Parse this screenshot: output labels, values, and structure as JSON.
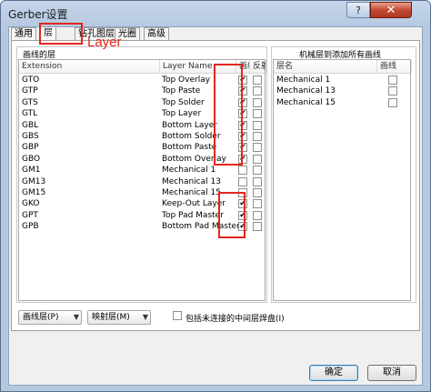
{
  "window": {
    "title": "Gerber设置",
    "help_label": "?",
    "close_label": "✕"
  },
  "tabs": [
    {
      "label": "通用",
      "active": false
    },
    {
      "label": "层",
      "active": true
    },
    {
      "label": "钻孔图层",
      "active": false
    },
    {
      "label": "光圈",
      "active": false
    },
    {
      "label": "高级",
      "active": false
    }
  ],
  "annotation": {
    "text": "Layer",
    "color": "#e5261f"
  },
  "left_group": {
    "title": "画线的层",
    "columns": [
      "Extension",
      "Layer Name",
      "画线",
      "反射"
    ],
    "rows": [
      {
        "ext": "GTO",
        "name": "Top Overlay",
        "plot": true,
        "mirror": false
      },
      {
        "ext": "GTP",
        "name": "Top Paste",
        "plot": true,
        "mirror": false
      },
      {
        "ext": "GTS",
        "name": "Top Solder",
        "plot": true,
        "mirror": false
      },
      {
        "ext": "GTL",
        "name": "Top Layer",
        "plot": true,
        "mirror": false
      },
      {
        "ext": "GBL",
        "name": "Bottom Layer",
        "plot": true,
        "mirror": false
      },
      {
        "ext": "GBS",
        "name": "Bottom Solder",
        "plot": true,
        "mirror": false
      },
      {
        "ext": "GBP",
        "name": "Bottom Paste",
        "plot": true,
        "mirror": false
      },
      {
        "ext": "GBO",
        "name": "Bottom Overlay",
        "plot": true,
        "mirror": false
      },
      {
        "ext": "GM1",
        "name": "Mechanical 1",
        "plot": false,
        "mirror": false
      },
      {
        "ext": "GM13",
        "name": "Mechanical 13",
        "plot": false,
        "mirror": false
      },
      {
        "ext": "GM15",
        "name": "Mechanical 15",
        "plot": false,
        "mirror": false
      },
      {
        "ext": "GKO",
        "name": "Keep-Out Layer",
        "plot": true,
        "mirror": false
      },
      {
        "ext": "GPT",
        "name": "Top Pad Master",
        "plot": true,
        "mirror": false
      },
      {
        "ext": "GPB",
        "name": "Bottom Pad Master",
        "plot": true,
        "mirror": false
      }
    ]
  },
  "right_group": {
    "title": "机械层到添加所有画线",
    "columns": [
      "层名",
      "画线"
    ],
    "rows": [
      {
        "name": "Mechanical 1",
        "plot": false
      },
      {
        "name": "Mechanical 13",
        "plot": false
      },
      {
        "name": "Mechanical 15",
        "plot": false
      }
    ]
  },
  "bottom": {
    "plot_layers_combo": "画线层(P)",
    "mirror_layers_combo": "映射层(M)",
    "include_unconnected_label": "包括未连接的中间层焊盘(I)",
    "include_unconnected_checked": false
  },
  "buttons": {
    "ok": "确定",
    "cancel": "取消"
  },
  "icons": {
    "combo_arrow": "chevron-down-icon",
    "check_mark": "✔"
  }
}
